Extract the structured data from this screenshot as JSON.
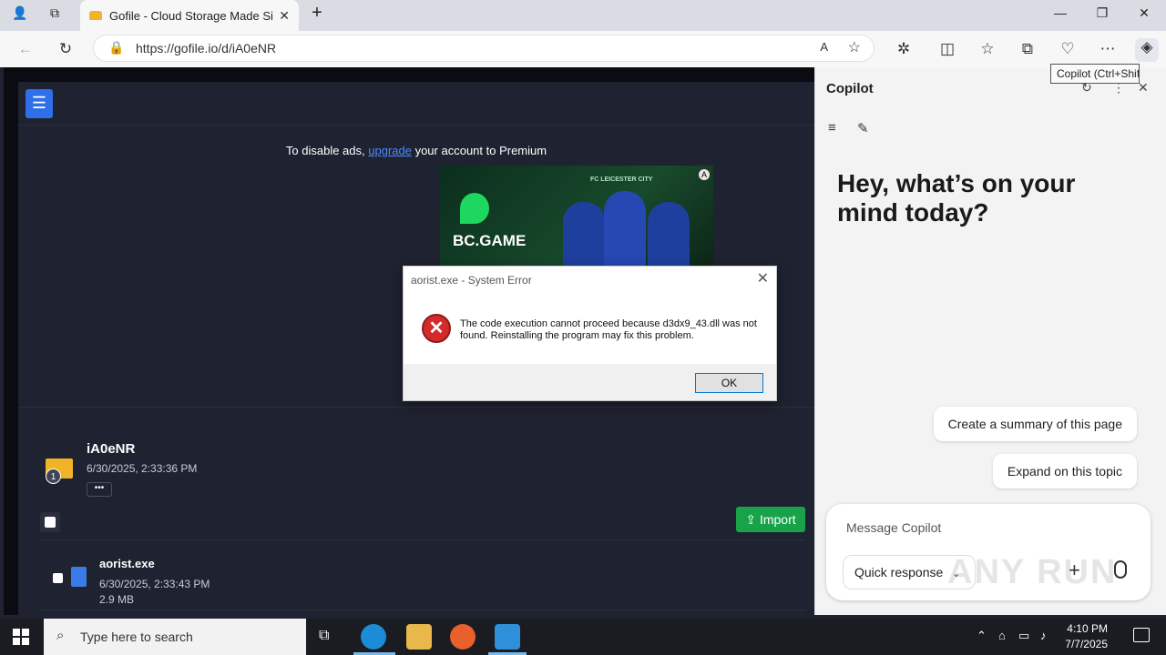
{
  "browser": {
    "tab_title": "Gofile - Cloud Storage Made Simp",
    "url": "https://gofile.io/d/iA0eNR",
    "tooltip": "Copilot (Ctrl+Shift+.)"
  },
  "site": {
    "ad_text_before": "To disable ads, ",
    "ad_link": "upgrade",
    "ad_text_after": " your account to Premium",
    "ad_brand": "BC.GAME",
    "ad_club": "FC LEICESTER CITY",
    "folder": {
      "name": "iA0eNR",
      "date": "6/30/2025, 2:33:36 PM",
      "count": "1",
      "more": "•••"
    },
    "import_label": "Import",
    "file": {
      "name": "aorist.exe",
      "date": "6/30/2025, 2:33:43 PM",
      "size": "2.9 MB"
    }
  },
  "dialog": {
    "title": "aorist.exe - System Error",
    "message": "The code execution cannot proceed because d3dx9_43.dll was not found. Reinstalling the program may fix this problem.",
    "ok_label": "OK"
  },
  "copilot": {
    "title": "Copilot",
    "greeting": "Hey, what’s on your mind today?",
    "suggestions": [
      "Create a summary of this page",
      "Expand on this topic"
    ],
    "input_placeholder": "Message Copilot",
    "quick_response": "Quick response",
    "watermark": "ANY RUN"
  },
  "taskbar": {
    "search_placeholder": "Type here to search",
    "time": "4:10 PM",
    "date": "7/7/2025"
  },
  "colors": {
    "page_bg": "#1f2230",
    "accent_blue": "#2f6fe8",
    "import_green": "#18a34a",
    "error_red": "#d42a2a"
  }
}
